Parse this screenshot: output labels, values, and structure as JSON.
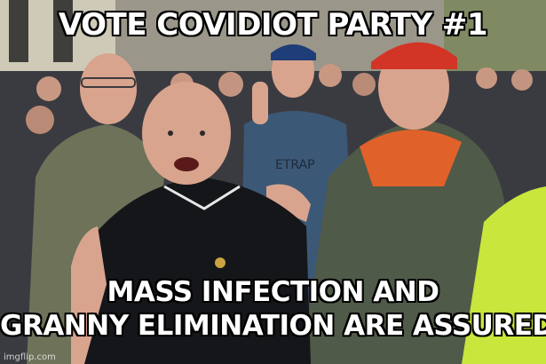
{
  "meme": {
    "top_text": "VOTE COVIDIOT PARTY #1",
    "bottom_line_1": "MASS INFECTION AND",
    "bottom_line_2": "GRANNY ELIMINATION ARE ASSURED",
    "watermark": "imgflip.com"
  },
  "photo": {
    "subject": "crowd of men at a street protest",
    "colors": {
      "building": "#cfcab8",
      "crowd_dark": "#2b2d33",
      "skin": "#d9a48e",
      "black_shirt": "#15161a",
      "green_jacket": "#4f5a48",
      "blue_hoodie": "#3c5877",
      "red_cap": "#d23526",
      "hi_vis": "#c8e63b",
      "jacket_left": "#6d7259"
    }
  }
}
